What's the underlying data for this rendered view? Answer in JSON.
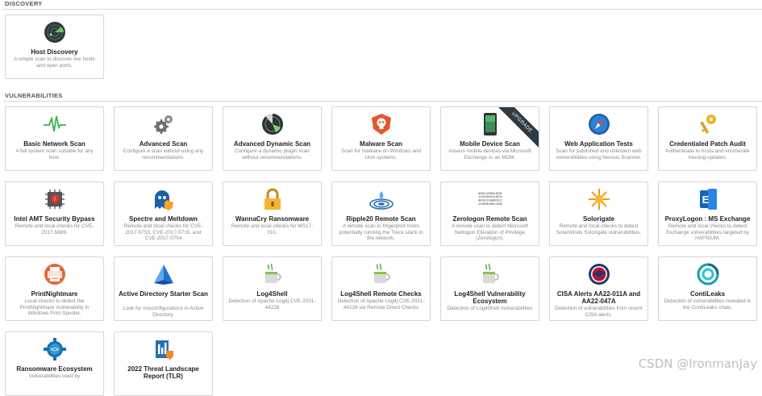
{
  "sections": {
    "discovery": "DISCOVERY",
    "vulnerabilities": "VULNERABILITIES"
  },
  "discovery_cards": [
    {
      "title": "Host Discovery",
      "desc": "A simple scan to discover live hosts and open ports.",
      "icon": "radar-icon"
    }
  ],
  "vuln_cards": [
    {
      "title": "Basic Network Scan",
      "desc": "A full system scan suitable for any host.",
      "icon": "pulse-icon"
    },
    {
      "title": "Advanced Scan",
      "desc": "Configure a scan without using any recommendations.",
      "icon": "gears-icon"
    },
    {
      "title": "Advanced Dynamic Scan",
      "desc": "Configure a dynamic plugin scan without recommendations.",
      "icon": "radar-dynamic-icon"
    },
    {
      "title": "Malware Scan",
      "desc": "Scan for malware on Windows and Unix systems.",
      "icon": "malware-icon"
    },
    {
      "title": "Mobile Device Scan",
      "desc": "Assess mobile devices via Microsoft Exchange or an MDM.",
      "icon": "phone-icon",
      "badge": "UPGRADE"
    },
    {
      "title": "Web Application Tests",
      "desc": "Scan for published and unknown web vulnerabilities using Nessus Scanner.",
      "icon": "compass-icon"
    },
    {
      "title": "Credentialed Patch Audit",
      "desc": "Authenticate to hosts and enumerate missing updates.",
      "icon": "keys-icon"
    },
    {
      "title": "Intel AMT Security Bypass",
      "desc": "Remote and local checks for CVE-2017-5689.",
      "icon": "chip-icon"
    },
    {
      "title": "Spectre and Meltdown",
      "desc": "Remote and local checks for CVE-2017-5753, CVE-2017-5715, and CVE-2017-5754",
      "icon": "ghost-icon"
    },
    {
      "title": "WannaCry Ransomware",
      "desc": "Remote and local checks for MS17-010.",
      "icon": "lock-icon"
    },
    {
      "title": "Ripple20 Remote Scan",
      "desc": "A remote scan to fingerprint hosts potentially running the Treck stack in the network.",
      "icon": "ripple-icon"
    },
    {
      "title": "Zerologon Remote Scan",
      "desc": "A remote scan to detect Microsoft Netlogon Elevation of Privilege (Zerologon).",
      "icon": "binary-icon"
    },
    {
      "title": "Solorigate",
      "desc": "Remote and local checks to detect SolarWinds Solorigate vulnerabilities.",
      "icon": "sun-icon"
    },
    {
      "title": "ProxyLogon : MS Exchange",
      "desc": "Remote and local checks to detect Exchange vulnerabilities targeted by HAFNIUM.",
      "icon": "exchange-icon"
    },
    {
      "title": "PrintNightmare",
      "desc": "Local checks to detect the PrintNightmare Vulnerability in Windows Print Spooler.",
      "icon": "printer-icon"
    },
    {
      "title": "Active Directory Starter Scan",
      "desc": "Look for misconfigurations in Active Directory.",
      "icon": "pyramid-icon"
    },
    {
      "title": "Log4Shell",
      "desc": "Detection of Apache Log4j CVE-2021-44228",
      "icon": "coffee-icon"
    },
    {
      "title": "Log4Shell Remote Checks",
      "desc": "Detection of Apache Log4j CVE-2021-44228 via Remote Direct Checks",
      "icon": "coffee-icon"
    },
    {
      "title": "Log4Shell Vulnerability Ecosystem",
      "desc": "Detection of Log4Shell Vulnerabilities",
      "icon": "coffee-icon"
    },
    {
      "title": "CISA Alerts AA22-011A and AA22-047A",
      "desc": "Detection of vulnerabilities from recent CISA alerts.",
      "icon": "cisa-icon"
    },
    {
      "title": "ContiLeaks",
      "desc": "Detection of vulnerabilities revealed in the ContiLeaks chats.",
      "icon": "conti-icon"
    },
    {
      "title": "Ransomware Ecosystem",
      "desc": "Vulnerabilities used by",
      "icon": "ransomware-icon"
    },
    {
      "title": "2022 Threat Landscape Report (TLR)",
      "desc": "",
      "icon": "report-icon"
    }
  ],
  "watermark": "CSDN @IronmanJay"
}
